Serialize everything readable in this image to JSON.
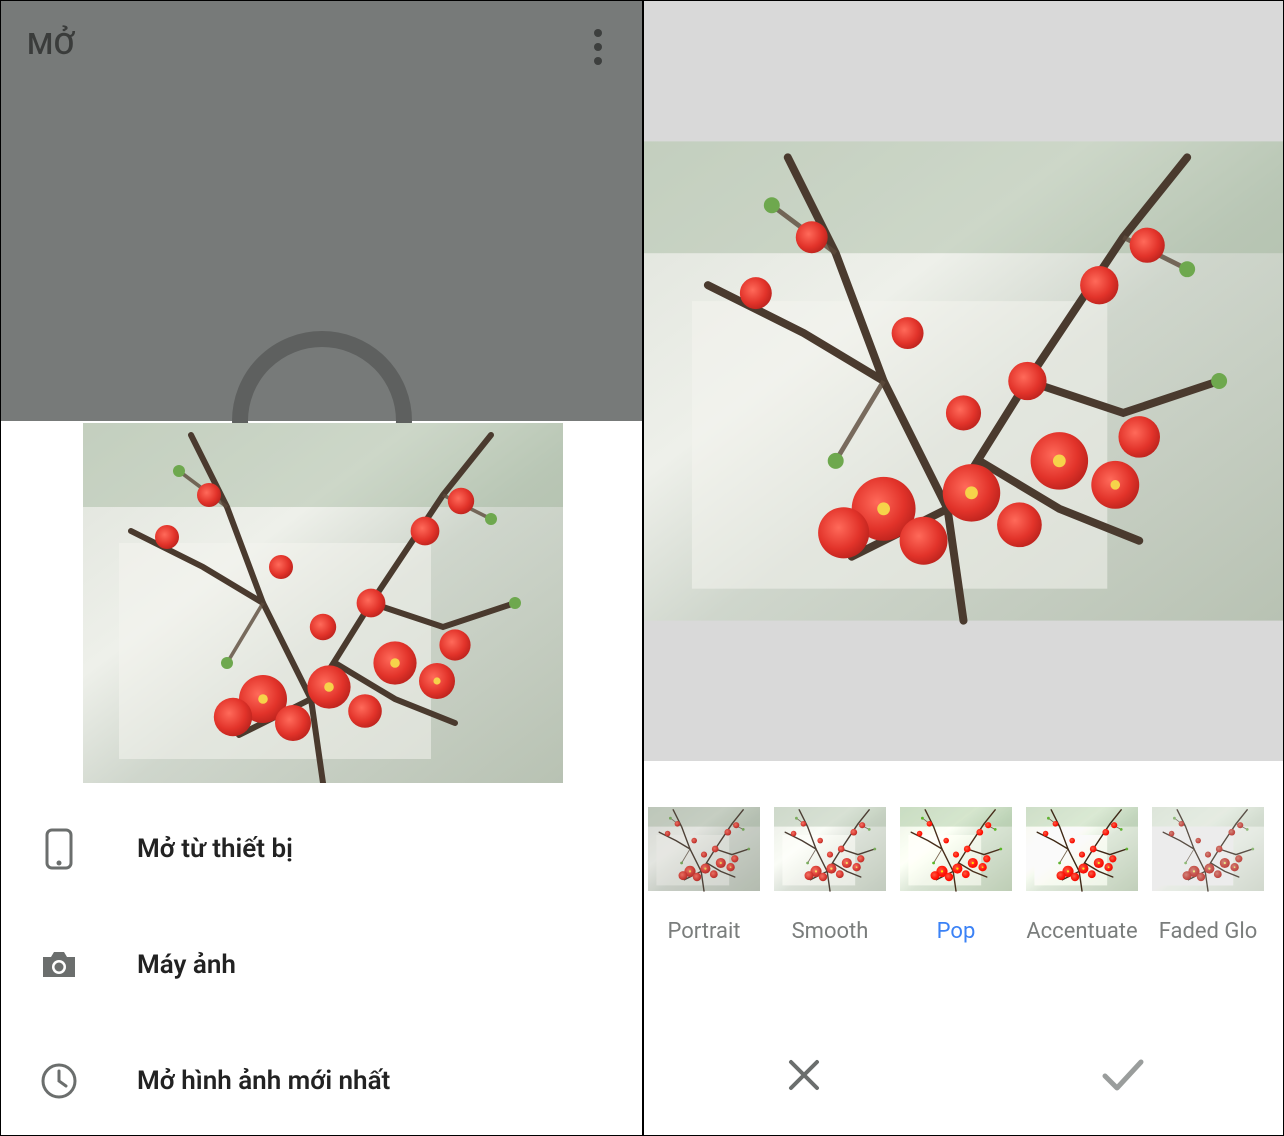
{
  "left": {
    "title": "MỞ",
    "menu": [
      {
        "icon": "device-icon",
        "label": "Mở từ thiết bị"
      },
      {
        "icon": "camera-icon",
        "label": "Máy ảnh"
      },
      {
        "icon": "recent-icon",
        "label": "Mở hình ảnh mới nhất"
      }
    ]
  },
  "right": {
    "filters": [
      {
        "name": "Portrait",
        "selected": false
      },
      {
        "name": "Smooth",
        "selected": false
      },
      {
        "name": "Pop",
        "selected": true
      },
      {
        "name": "Accentuate",
        "selected": false
      },
      {
        "name": "Faded Glo",
        "selected": false
      }
    ],
    "actions": {
      "cancel": "×",
      "apply": "✓"
    }
  },
  "colors": {
    "accent": "#3b82f6"
  }
}
